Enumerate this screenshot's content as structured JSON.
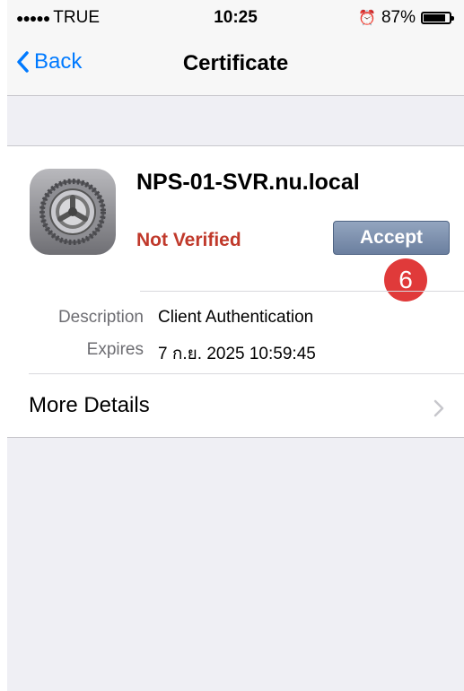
{
  "status_bar": {
    "carrier": "TRUE",
    "time": "10:25",
    "battery_percent": "87%",
    "battery_level": 0.87
  },
  "nav": {
    "back_label": "Back",
    "title": "Certificate"
  },
  "certificate": {
    "name": "NPS-01-SVR.nu.local",
    "status": "Not Verified",
    "accept_label": "Accept",
    "step_badge": "6",
    "details": [
      {
        "label": "Description",
        "value": "Client Authentication"
      },
      {
        "label": "Expires",
        "value": "7 ก.ย. 2025 10:59:45"
      }
    ],
    "more_details_label": "More Details"
  },
  "colors": {
    "accent": "#007aff",
    "status_red": "#c0392b",
    "badge_red": "#e03a3a",
    "button_blue_gray": "#7f92b1"
  }
}
